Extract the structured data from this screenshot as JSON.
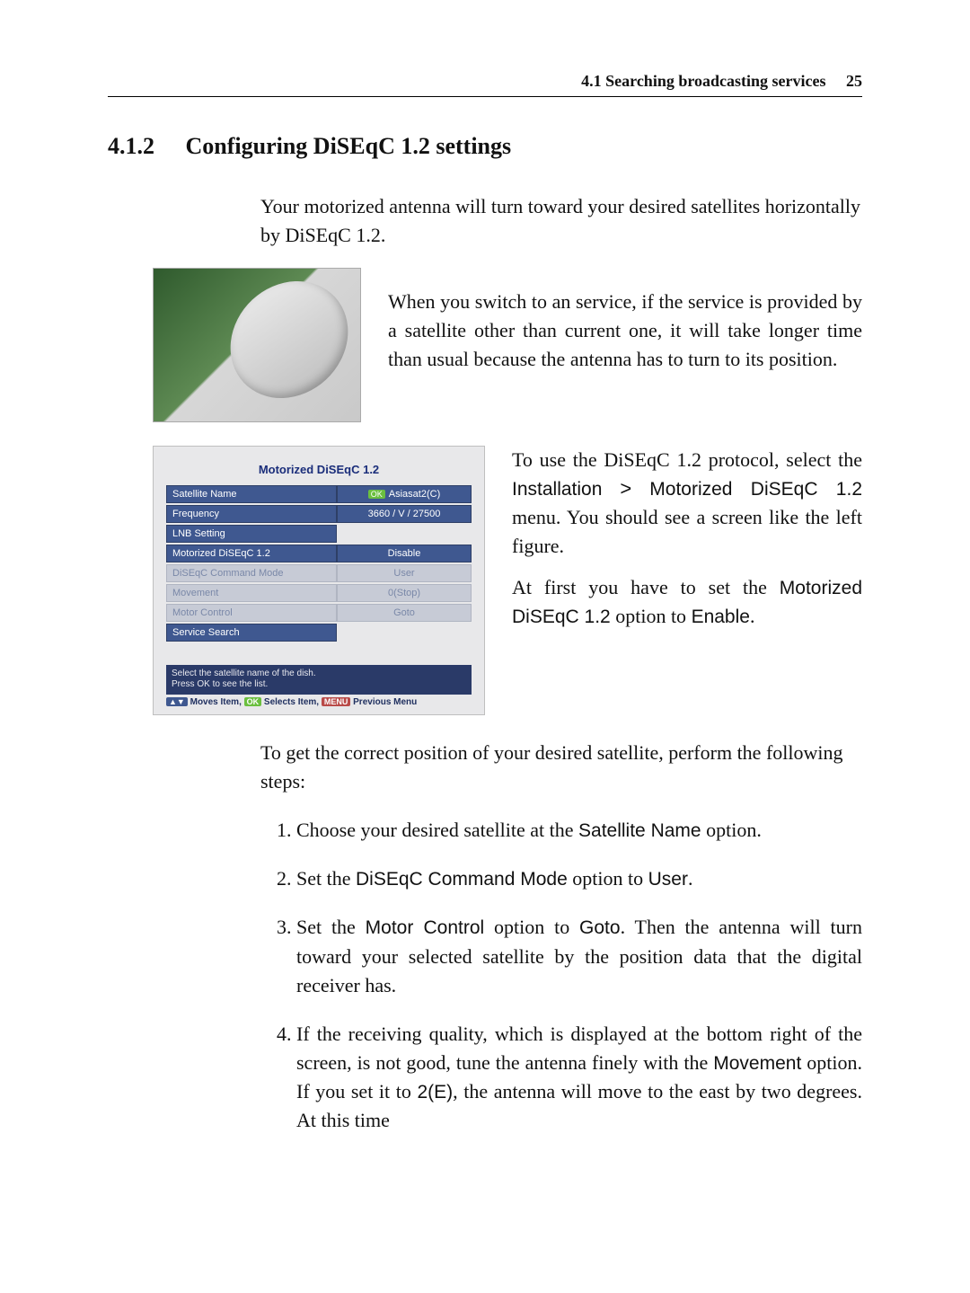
{
  "running_head": {
    "section": "4.1 Searching broadcasting services",
    "page": "25"
  },
  "heading": {
    "number": "4.1.2",
    "title": "Configuring DiSEqC 1.2 settings"
  },
  "intro": "Your motorized antenna will turn toward your desired satellites horizontally by DiSEqC 1.2.",
  "para_top": "When you switch to an service, if the service is provided by a satellite other than current one, it will take longer time than usual because the antenna has to turn to its position.",
  "menu": {
    "title": "Motorized DiSEqC 1.2",
    "rows": [
      {
        "label": "Satellite Name",
        "value": "Asiasat2(C)",
        "disabled": false,
        "ok": true
      },
      {
        "label": "Frequency",
        "value": "3660 / V / 27500",
        "disabled": false
      },
      {
        "label": "LNB Setting",
        "value": "",
        "disabled": false,
        "novalbox": true
      },
      {
        "label": "Motorized DiSEqC 1.2",
        "value": "Disable",
        "disabled": false
      },
      {
        "label": "DiSEqC Command Mode",
        "value": "User",
        "disabled": true
      },
      {
        "label": "Movement",
        "value": "0(Stop)",
        "disabled": true
      },
      {
        "label": "Motor Control",
        "value": "Goto",
        "disabled": true
      },
      {
        "label": "Service Search",
        "value": "",
        "disabled": false,
        "novalbox": true
      }
    ],
    "hint1": "Select the satellite name of the dish.",
    "hint2": "Press OK to see the list.",
    "nav_moves": "Moves Item,",
    "nav_selects": "Selects Item,",
    "nav_prev": "Previous Menu"
  },
  "side": {
    "p1a": "To use the DiSEqC 1.2 protocol, select the ",
    "p1b_installation": "Installation",
    "p1c_gt": ">",
    "p1d_motorized": "Motorized DiSEqC 1.2",
    "p1e": " menu. You should see a screen like the left figure.",
    "p2a": "At first you have to set the ",
    "p2b_motorized": "Motorized DiSEqC 1.2",
    "p2c": " option to ",
    "p2d_enable": "Enable",
    "p2e": "."
  },
  "after": "To get the correct position of your desired satellite, perform the following steps:",
  "steps": {
    "s1a": "Choose your desired satellite at the ",
    "s1b_sat": "Satellite Name",
    "s1c": " option.",
    "s2a": "Set the ",
    "s2b_dcm": "DiSEqC Command Mode",
    "s2c": " option to ",
    "s2d_user": "User",
    "s2e": ".",
    "s3a": "Set the ",
    "s3b_mc": "Motor Control",
    "s3c": " option to ",
    "s3d_goto": "Goto",
    "s3e": ". Then the antenna will turn toward your selected satellite by the position data that the digital receiver has.",
    "s4a": "If the receiving quality, which is displayed at the bottom right of the screen, is not good, tune the antenna finely with the ",
    "s4b_mov": "Movement",
    "s4c": " option. If you set it to ",
    "s4d_2e": "2(E)",
    "s4e": ", the antenna will move to the east by two degrees. At this time"
  }
}
